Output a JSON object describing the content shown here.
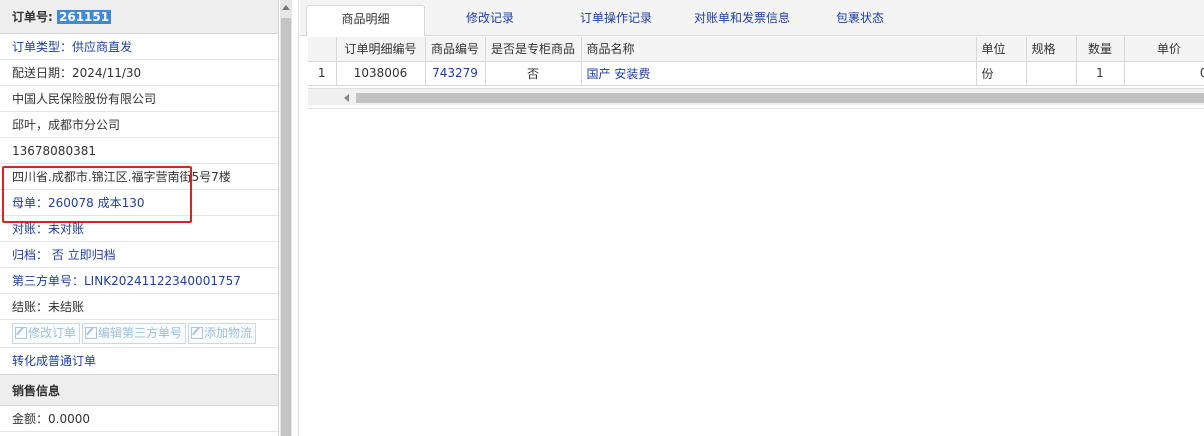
{
  "left": {
    "order_label": "订单号:",
    "order_no": "261151",
    "rows": [
      "订单类型：供应商直发",
      "配送日期：2024/11/30",
      "中国人民保险股份有限公司",
      "邱叶，成都市分公司",
      "13678080381",
      "四川省.成都市.锦江区.福字营南街5号7楼",
      "母单：260078 成本130",
      "对账：未对账",
      "归档： 否 立即归档",
      "第三方单号：LINK20241122340001757",
      "结账：未结账"
    ],
    "buttons": [
      "修改订单",
      "编辑第三方单号",
      "添加物流"
    ],
    "convert_link": "转化成普通订单",
    "section_title": "销售信息",
    "amount": "金额：0.0000"
  },
  "tabs": [
    "商品明细",
    "修改记录",
    "订单操作记录",
    "对账单和发票信息",
    "包裹状态"
  ],
  "grid": {
    "headers": [
      "",
      "订单明细编号",
      "商品编号",
      "是否是专柜商品",
      "商品名称",
      "单位",
      "规格",
      "数量",
      "单价"
    ],
    "rows": [
      [
        "1",
        "1038006",
        "743279",
        "否",
        "国产 安装费",
        "份",
        "",
        "1",
        "0"
      ]
    ]
  },
  "colors": {
    "link": "#1e3fa0",
    "highlight": "#e02020",
    "selected": "#3d8bd8"
  }
}
